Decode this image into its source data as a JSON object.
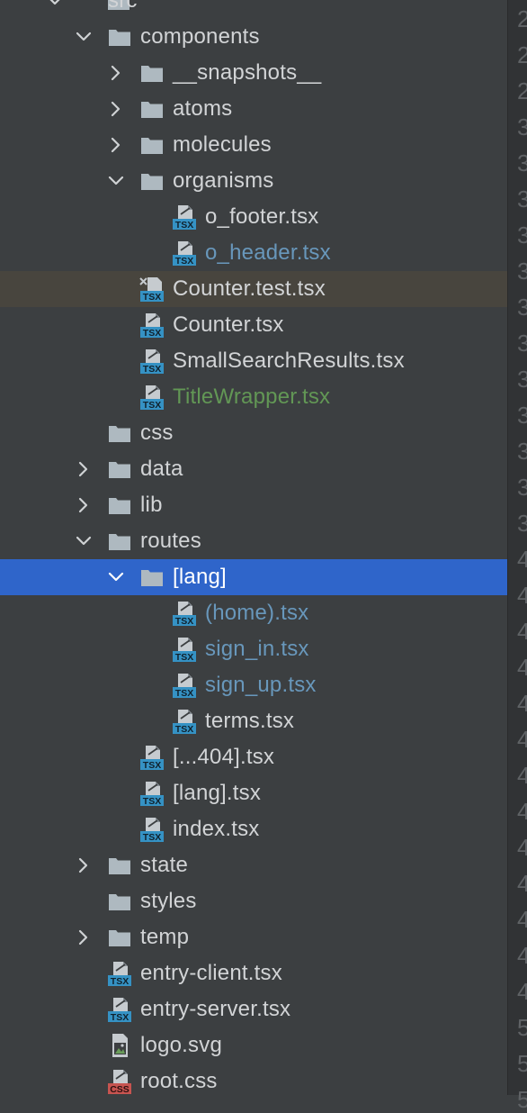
{
  "tree": {
    "rows": [
      {
        "label": "src",
        "level": 1,
        "kind": "folder",
        "chevron": "down",
        "status": "normal"
      },
      {
        "label": "components",
        "level": 2,
        "kind": "folder",
        "chevron": "down",
        "status": "normal"
      },
      {
        "label": "__snapshots__",
        "level": 3,
        "kind": "folder",
        "chevron": "right",
        "status": "normal"
      },
      {
        "label": "atoms",
        "level": 3,
        "kind": "folder",
        "chevron": "right",
        "status": "normal"
      },
      {
        "label": "molecules",
        "level": 3,
        "kind": "folder",
        "chevron": "right",
        "status": "normal"
      },
      {
        "label": "organisms",
        "level": 3,
        "kind": "folder",
        "chevron": "down",
        "status": "normal"
      },
      {
        "label": "o_footer.tsx",
        "level": 4,
        "kind": "tsx",
        "status": "normal"
      },
      {
        "label": "o_header.tsx",
        "level": 4,
        "kind": "tsx",
        "status": "modified"
      },
      {
        "label": "Counter.test.tsx",
        "level": 3,
        "kind": "test-tsx",
        "status": "normal",
        "state": "highlighted"
      },
      {
        "label": "Counter.tsx",
        "level": 3,
        "kind": "tsx",
        "status": "normal"
      },
      {
        "label": "SmallSearchResults.tsx",
        "level": 3,
        "kind": "tsx",
        "status": "normal"
      },
      {
        "label": "TitleWrapper.tsx",
        "level": 3,
        "kind": "tsx",
        "status": "added"
      },
      {
        "label": "css",
        "level": 2,
        "kind": "folder",
        "chevron": "none",
        "status": "normal"
      },
      {
        "label": "data",
        "level": 2,
        "kind": "folder",
        "chevron": "right",
        "status": "normal"
      },
      {
        "label": "lib",
        "level": 2,
        "kind": "folder",
        "chevron": "right",
        "status": "normal"
      },
      {
        "label": "routes",
        "level": 2,
        "kind": "folder",
        "chevron": "down",
        "status": "normal"
      },
      {
        "label": "[lang]",
        "level": 3,
        "kind": "folder",
        "chevron": "down",
        "status": "normal",
        "state": "selected"
      },
      {
        "label": "(home).tsx",
        "level": 4,
        "kind": "tsx",
        "status": "modified"
      },
      {
        "label": "sign_in.tsx",
        "level": 4,
        "kind": "tsx",
        "status": "modified"
      },
      {
        "label": "sign_up.tsx",
        "level": 4,
        "kind": "tsx",
        "status": "modified"
      },
      {
        "label": "terms.tsx",
        "level": 4,
        "kind": "tsx",
        "status": "normal"
      },
      {
        "label": "[...404].tsx",
        "level": 3,
        "kind": "tsx",
        "status": "normal"
      },
      {
        "label": "[lang].tsx",
        "level": 3,
        "kind": "tsx",
        "status": "normal"
      },
      {
        "label": "index.tsx",
        "level": 3,
        "kind": "tsx",
        "status": "normal"
      },
      {
        "label": "state",
        "level": 2,
        "kind": "folder",
        "chevron": "right",
        "status": "normal"
      },
      {
        "label": "styles",
        "level": 2,
        "kind": "folder",
        "chevron": "none",
        "status": "normal"
      },
      {
        "label": "temp",
        "level": 2,
        "kind": "folder",
        "chevron": "right",
        "status": "normal"
      },
      {
        "label": "entry-client.tsx",
        "level": 2,
        "kind": "tsx",
        "status": "normal"
      },
      {
        "label": "entry-server.tsx",
        "level": 2,
        "kind": "tsx",
        "status": "normal"
      },
      {
        "label": "logo.svg",
        "level": 2,
        "kind": "svg",
        "status": "normal"
      },
      {
        "label": "root.css",
        "level": 2,
        "kind": "css",
        "status": "normal"
      }
    ]
  },
  "gutter": {
    "line_digits": [
      "2",
      "2",
      "2",
      "3",
      "3",
      "3",
      "3",
      "3",
      "3",
      "3",
      "3",
      "3",
      "3",
      "3",
      "3",
      "4",
      "4",
      "4",
      "4",
      "4",
      "4",
      "4",
      "4",
      "4",
      "4",
      "4",
      "4",
      "4",
      "5",
      "5",
      "5"
    ]
  },
  "colors": {
    "panel_bg": "#3c3f41",
    "selected_bg": "#2f65ca",
    "highlight_bg": "#48453e",
    "text_normal": "#d2d4d6",
    "text_modified": "#6897bb",
    "text_added": "#629755",
    "folder_icon": "#aeb9c0",
    "tsx_badge": "#3592c4",
    "css_badge": "#c75450"
  }
}
